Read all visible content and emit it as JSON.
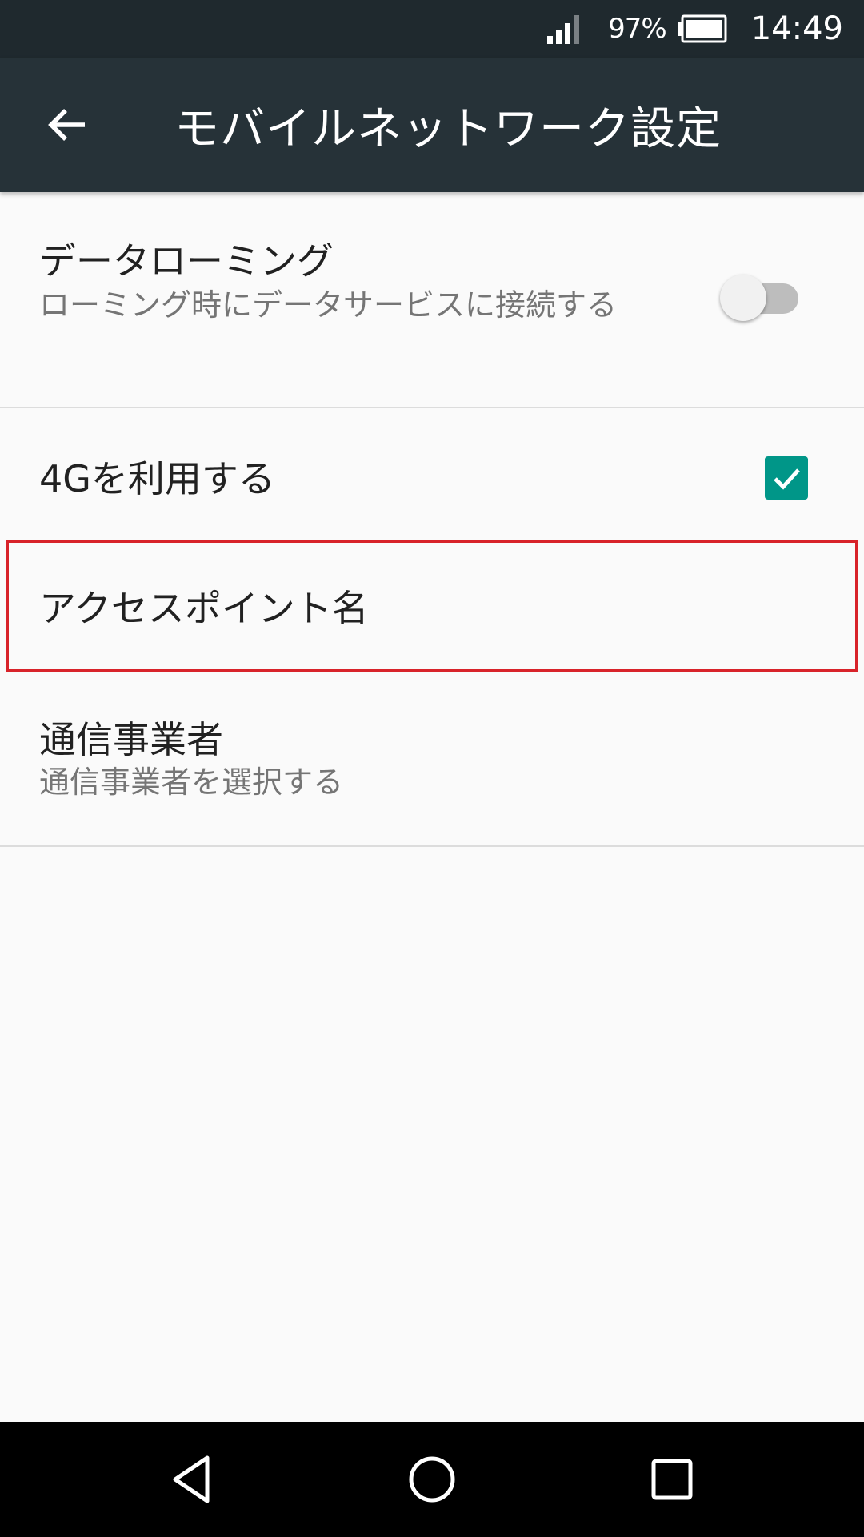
{
  "status_bar": {
    "battery_percent": "97%",
    "clock": "14:49"
  },
  "app_bar": {
    "title": "モバイルネットワーク設定"
  },
  "settings": {
    "data_roaming": {
      "title": "データローミング",
      "summary": "ローミング時にデータサービスに接続する",
      "enabled": false
    },
    "use_4g": {
      "title": "4Gを利用する",
      "checked": true
    },
    "access_point_names": {
      "title": "アクセスポイント名"
    },
    "network_operators": {
      "title": "通信事業者",
      "summary": "通信事業者を選択する"
    }
  },
  "colors": {
    "status_bar": "#1f292e",
    "app_bar": "#263238",
    "accent": "#009688",
    "highlight": "#d8232a",
    "background": "#fafafa"
  },
  "icons": {
    "back": "arrow-left-icon",
    "signal": "signal-icon",
    "battery": "battery-icon",
    "nav_back": "triangle-back-icon",
    "nav_home": "circle-home-icon",
    "nav_recents": "square-recents-icon",
    "check": "checkmark-icon"
  }
}
